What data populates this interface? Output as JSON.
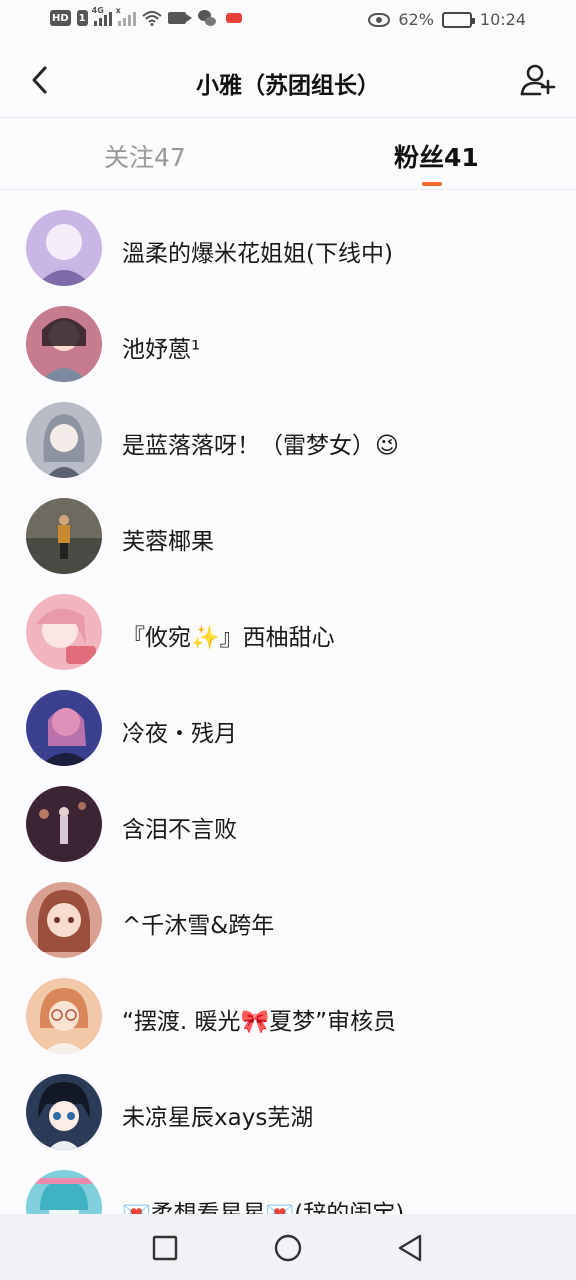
{
  "status_bar": {
    "network_1": "4G",
    "network_2": "x",
    "battery": "62%",
    "time": "10:24"
  },
  "header": {
    "title": "小雅（苏团组长）"
  },
  "tabs": {
    "follow": "关注47",
    "fans": "粉丝41"
  },
  "fans": [
    {
      "name": "溫柔的爆米花姐姐(下线中)",
      "avatar_color": "#c9b6e4"
    },
    {
      "name": "池妤蒽¹",
      "avatar_color": "#c77b8f"
    },
    {
      "name": "是蓝落落呀！（雷梦女）😉",
      "avatar_color": "#b7bcc6"
    },
    {
      "name": "芙蓉椰果",
      "avatar_color": "#6d6a5f"
    },
    {
      "name": "『攸宛✨』西柚甜心",
      "avatar_color": "#f0b5bf"
    },
    {
      "name": "冷夜・残月",
      "avatar_color": "#3a3f8f"
    },
    {
      "name": "含泪不言败",
      "avatar_color": "#3d2434"
    },
    {
      "name": "^千沐雪&跨年",
      "avatar_color": "#d9a192"
    },
    {
      "name": "“摆渡. 暖光🎀夏梦”审核员",
      "avatar_color": "#f2c9a8"
    },
    {
      "name": "未凉星辰xays芜湖",
      "avatar_color": "#2a3b57"
    },
    {
      "name": "💌柔想看星星💌(辞的闺宝)",
      "avatar_color": "#7fd0dc"
    }
  ]
}
